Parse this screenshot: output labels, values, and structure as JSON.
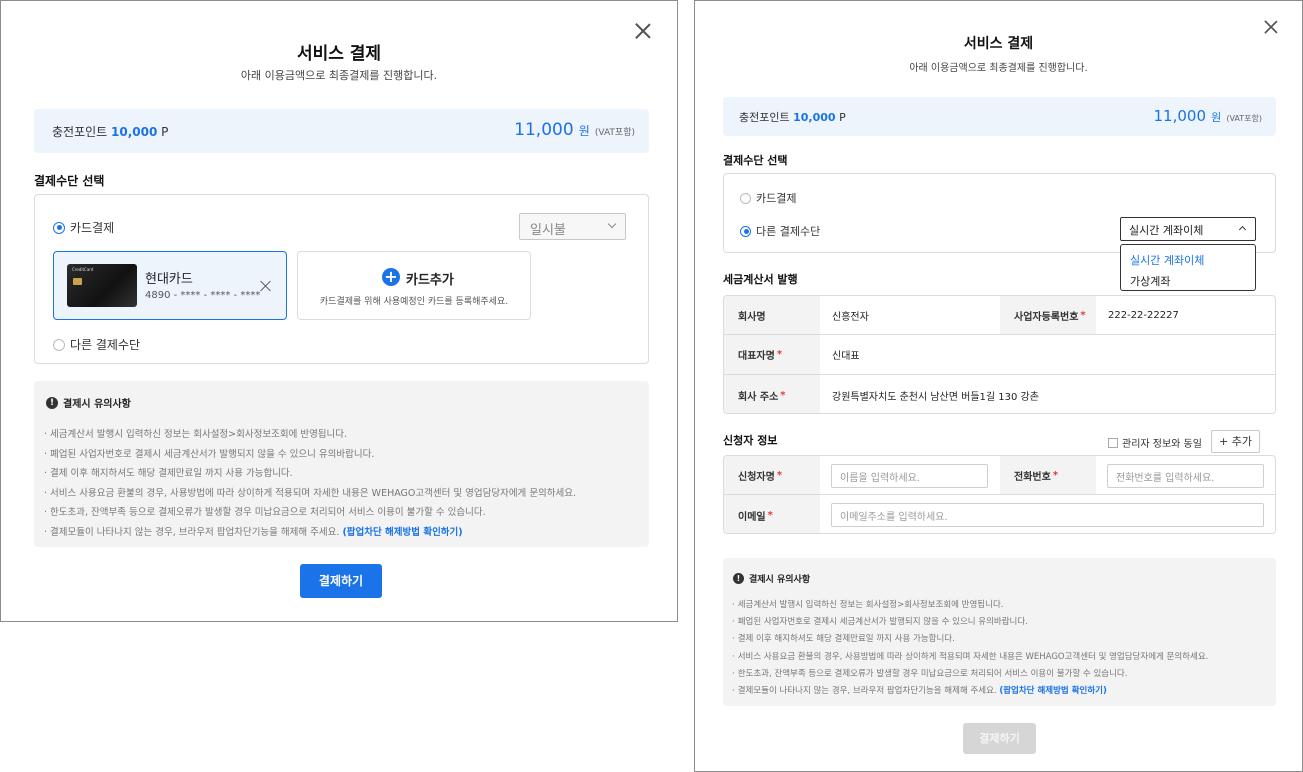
{
  "dialog1": {
    "title": "서비스 결제",
    "subtitle": "아래 이용금액으로 최종결제를 진행합니다.",
    "points_label": "충전포인트",
    "points_value": "10,000",
    "points_unit": "P",
    "amount_value": "11,000",
    "amount_unit": "원",
    "vat_note": "(VAT포함)",
    "payment_method_title": "결제수단 선택",
    "radio_card": "카드결제",
    "installment": {
      "selected": "일시불"
    },
    "card": {
      "name": "현대카드",
      "number": "4890 - **** - **** - ****",
      "logo_text": "CreditCard"
    },
    "add_card": {
      "label": "카드추가",
      "desc": "카드결제를 위해 사용예정인 카드를 등록해주세요.",
      "plus": "+"
    },
    "radio_other": "다른 결제수단",
    "notice": {
      "title": "결제시 유의사항",
      "icon_glyph": "!",
      "items": [
        "세금계산서 발행시 입력하신 정보는 회사설정>회사정보조회에 반영됩니다.",
        "폐업된 사업자번호로 결제시 세금계산서가 발행되지 않을 수 있으니 유의바랍니다.",
        "결제 이후 해지하셔도 해당 결제만료일 까지 사용 가능합니다.",
        "서비스 사용요금 환불의 경우, 사용방법에 따라 상이하게 적용되며 자세한 내용은 WEHAGO고객센터 및 영업담당자에게 문의하세요.",
        "한도초과, 잔액부족 등으로 결제오류가 발생할 경우 미납요금으로 처리되어 서비스 이용이 불가할 수 있습니다."
      ],
      "last_item": "결제모듈이 나타나지 않는 경우, 브라우저 팝업차단기능을 해제해 주세요.",
      "link": "(팝업차단 해제방법 확인하기)"
    },
    "pay_button": "결제하기"
  },
  "dialog2": {
    "title": "서비스 결제",
    "subtitle": "아래 이용금액으로 최종결제를 진행합니다.",
    "points_label": "충전포인트",
    "points_value": "10,000",
    "points_unit": "P",
    "amount_value": "11,000",
    "amount_unit": "원",
    "vat_note": "(VAT포함)",
    "payment_method_title": "결제수단 선택",
    "radio_card": "카드결제",
    "radio_other": "다른 결제수단",
    "method_select": "실시간 계좌이체",
    "method_options": [
      "실시간 계좌이체",
      "가상계좌"
    ],
    "tax_title": "세금계산서 발행",
    "tax": {
      "company_label": "회사명",
      "company_value": "신흥전자",
      "bizno_label": "사업자등록번호",
      "bizno_value": "222-22-22227",
      "ceo_label": "대표자명",
      "ceo_value": "신대표",
      "address_label": "회사 주소",
      "address_value": "강원특별자치도 춘천시 남산면 버들1길 130 강촌"
    },
    "applicant_title": "신청자 정보",
    "same_as_admin": "관리자 정보와 동일",
    "add_button": "+ 추가",
    "applicant": {
      "name_label": "신청자명",
      "name_placeholder": "이름을 입력하세요.",
      "phone_label": "전화번호",
      "phone_placeholder": "전화번호를 입력하세요.",
      "email_label": "이메일",
      "email_placeholder": "이메일주소를 입력하세요."
    },
    "required_mark": "*",
    "notice": {
      "title": "결제시 유의사항",
      "icon_glyph": "!",
      "items": [
        "세금계산서 발행시 입력하신 정보는 회사설정>회사정보조회에 반영됩니다.",
        "폐업된 사업자번호로 결제시 세금계산서가 발행되지 않을 수 있으니 유의바랍니다.",
        "결제 이후 해지하셔도 해당 결제만료일 까지 사용 가능합니다.",
        "서비스 사용요금 환불의 경우, 사용방법에 따라 상이하게 적용되며 자세한 내용은 WEHAGO고객센터 및 영업담당자에게 문의하세요.",
        "한도초과, 잔액부족 등으로 결제오류가 발생할 경우 미납요금으로 처리되어 서비스 이용이 불가할 수 있습니다."
      ],
      "last_item": "결제모듈이 나타나지 않는 경우, 브라우저 팝업차단기능을 해제해 주세요.",
      "link": "(팝업차단 해제방법 확인하기)"
    },
    "pay_button": "결제하기"
  },
  "colors": {
    "accent": "#1a73e8",
    "required": "#e53935",
    "disabled": "#d6d6d6"
  }
}
